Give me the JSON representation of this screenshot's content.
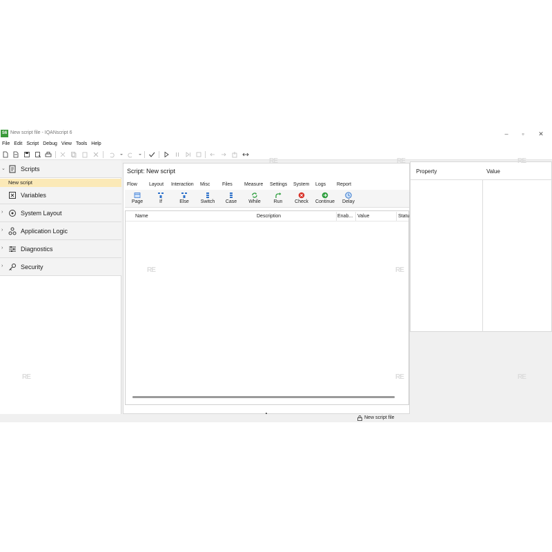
{
  "window": {
    "app_icon_text": "S6",
    "title": "New script file - IQANscript 6",
    "controls": [
      "minimize",
      "maximize",
      "close"
    ]
  },
  "menu": [
    "File",
    "Edit",
    "Script",
    "Debug",
    "View",
    "Tools",
    "Help"
  ],
  "toolbar_icons": [
    "new-file-icon",
    "open-file-icon",
    "save-icon",
    "save-as-icon",
    "print-icon",
    "cut-icon",
    "copy-icon",
    "paste-icon",
    "delete-icon",
    "undo-icon",
    "redo-icon",
    "check-icon",
    "play-icon",
    "pause-icon",
    "step-icon",
    "stop-icon",
    "arrow-left-icon",
    "arrow-right-icon",
    "export-icon",
    "connect-icon"
  ],
  "nav": {
    "items": [
      {
        "label": "Scripts",
        "icon": "scripts-icon",
        "expanded": true
      },
      {
        "label": "Variables",
        "icon": "variables-icon"
      },
      {
        "label": "System Layout",
        "icon": "system-layout-icon"
      },
      {
        "label": "Application Logic",
        "icon": "application-logic-icon"
      },
      {
        "label": "Diagnostics",
        "icon": "diagnostics-icon"
      },
      {
        "label": "Security",
        "icon": "security-key-icon"
      }
    ],
    "selected_script": "New script"
  },
  "editor": {
    "title": "Script: New script",
    "ribbon_tabs": [
      "Flow",
      "Layout",
      "Interaction",
      "Misc",
      "Files",
      "Measure",
      "Settings",
      "System",
      "Logs",
      "Report"
    ],
    "tools": [
      {
        "label": "Page",
        "icon": "page-icon",
        "color": "#3a7bd5"
      },
      {
        "label": "If",
        "icon": "if-icon",
        "color": "#2a6fc9"
      },
      {
        "label": "Else",
        "icon": "else-icon",
        "color": "#2a6fc9"
      },
      {
        "label": "Switch",
        "icon": "switch-icon",
        "color": "#2a6fc9"
      },
      {
        "label": "Case",
        "icon": "case-icon",
        "color": "#2a6fc9"
      },
      {
        "label": "While",
        "icon": "while-icon",
        "color": "#2e9e3e"
      },
      {
        "label": "Run",
        "icon": "run-icon",
        "color": "#2e9e3e"
      },
      {
        "label": "Check",
        "icon": "check-error-icon",
        "color": "#d9342b"
      },
      {
        "label": "Continue",
        "icon": "continue-icon",
        "color": "#2e9e3e"
      },
      {
        "label": "Delay",
        "icon": "delay-icon",
        "color": "#2a6fc9"
      }
    ],
    "columns": [
      "Name",
      "Description",
      "Enab...",
      "Value",
      "Statu"
    ]
  },
  "properties": {
    "columns": [
      "Property",
      "Value"
    ]
  },
  "status": {
    "file": "New script file"
  },
  "watermark_text": "RE"
}
